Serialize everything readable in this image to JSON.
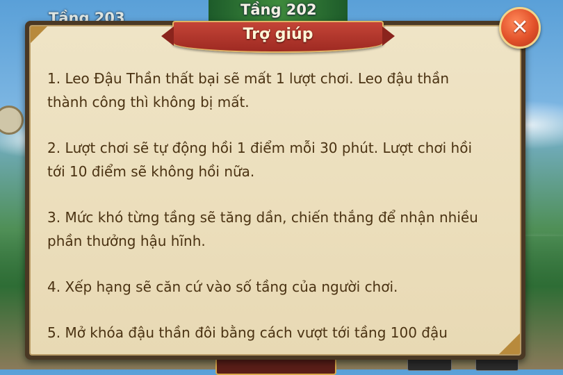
{
  "background": {
    "floor_prev": "Tầng 203",
    "floor_current": "Tầng 202"
  },
  "dialog": {
    "title": "Trợ giúp",
    "close_icon": "close-icon",
    "close_glyph": "✕",
    "items": [
      "1. Leo Đậu Thần thất bại sẽ mất 1 lượt chơi. Leo đậu thần thành công thì không bị mất.",
      "2. Lượt chơi sẽ tự động hồi 1 điểm mỗi 30 phút. Lượt chơi hồi tới 10 điểm sẽ không hồi nữa.",
      "3. Mức khó từng tầng sẽ tăng dần, chiến thắng để nhận nhiều phần thưởng hậu hĩnh.",
      "4. Xếp hạng sẽ căn cứ vào số tầng của người chơi.",
      "5. Mở khóa đậu thần đôi bằng cách vượt tới tầng 100 đậu"
    ]
  },
  "colors": {
    "parchment": "#ecdfbd",
    "text": "#4a3212",
    "ribbon": "#9e2a22",
    "close_button": "#e2512a"
  }
}
